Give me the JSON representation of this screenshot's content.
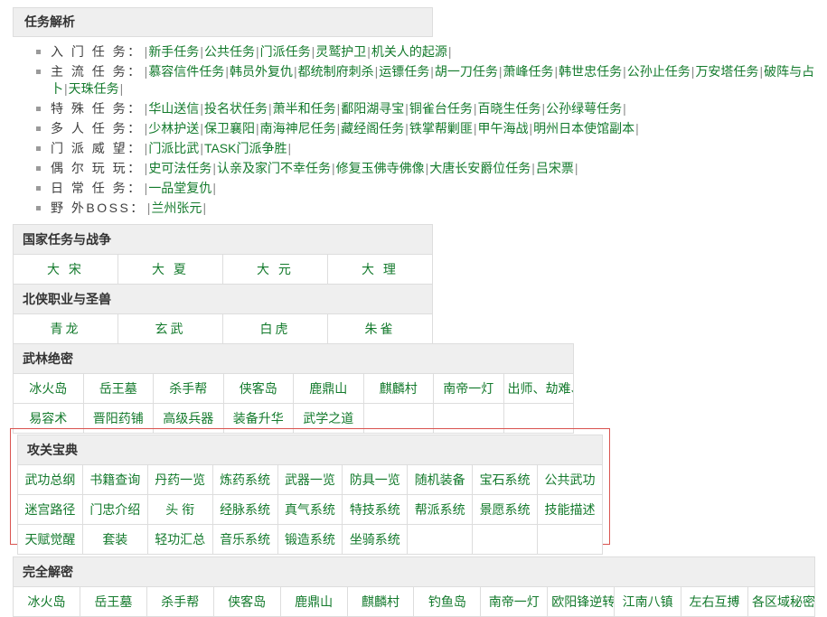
{
  "task_parse": {
    "title": "任务解析",
    "rows": [
      {
        "label": "入 门 任 务：",
        "links": [
          "新手任务",
          "公共任务",
          "门派任务",
          "灵鹫护卫",
          "机关人的起源"
        ]
      },
      {
        "label": "主 流 任 务：",
        "links": [
          "慕容信件任务",
          "韩员外复仇",
          "都统制府刺杀",
          "运镖任务",
          "胡一刀任务",
          "萧峰任务",
          "韩世忠任务",
          "公孙止任务",
          "万安塔任务",
          "破阵与占卜",
          "天珠任务"
        ]
      },
      {
        "label": "特 殊 任 务：",
        "links": [
          "华山送信",
          "投名状任务",
          "萧半和任务",
          "鄱阳湖寻宝",
          "铜雀台任务",
          "百晓生任务",
          "公孙绿萼任务"
        ]
      },
      {
        "label": "多 人 任 务：",
        "links": [
          "少林护送",
          "保卫襄阳",
          "南海神尼任务",
          "藏经阁任务",
          "铁掌帮剿匪",
          "甲午海战",
          "明州日本使馆副本"
        ]
      },
      {
        "label": "门 派 威 望：",
        "links": [
          "门派比武",
          "TASK门派争胜"
        ]
      },
      {
        "label": "偶 尔 玩 玩：",
        "links": [
          "史可法任务",
          "认亲及家门不幸任务",
          "修复玉佛寺佛像",
          "大唐长安爵位任务",
          "吕宋票"
        ]
      },
      {
        "label": "日 常 任 务：",
        "links": [
          "一品堂复仇"
        ]
      },
      {
        "label": "野 外BOSS：",
        "links": [
          "兰州张元"
        ]
      }
    ]
  },
  "nation_table": {
    "sections": [
      {
        "title": "国家任务与战争",
        "cells": [
          "大 宋",
          "大 夏",
          "大 元",
          "大 理"
        ]
      },
      {
        "title": "北侠职业与圣兽",
        "cells": [
          "青龙",
          "玄武",
          "白虎",
          "朱雀"
        ]
      }
    ]
  },
  "wulin_table": {
    "title": "武林绝密",
    "rows": [
      [
        "冰火岛",
        "岳王墓",
        "杀手帮",
        "侠客岛",
        "鹿鼎山",
        "麒麟村",
        "南帝一灯",
        "出师、劫难、宗师挑战"
      ],
      [
        "易容术",
        "晋阳药铺",
        "高级兵器",
        "装备升华",
        "武学之道",
        "",
        "",
        ""
      ]
    ]
  },
  "gongguan_table": {
    "title": "攻关宝典",
    "highlight_color": "#d9534f",
    "rows": [
      [
        "武功总纲",
        "书籍查询",
        "丹药一览",
        "炼药系统",
        "武器一览",
        "防具一览",
        "随机装备",
        "宝石系统",
        "公共武功"
      ],
      [
        "迷宫路径",
        "门忠介绍",
        "头 衔",
        "经脉系统",
        "真气系统",
        "特技系统",
        "帮派系统",
        "景愿系统",
        "技能描述"
      ],
      [
        "天赋觉醒",
        "套装",
        "轻功汇总",
        "音乐系统",
        "锻造系统",
        "坐骑系统",
        "",
        "",
        ""
      ]
    ]
  },
  "jiemi_table": {
    "title": "完全解密",
    "rows": [
      [
        "冰火岛",
        "岳王墓",
        "杀手帮",
        "侠客岛",
        "鹿鼎山",
        "麒麟村",
        "钓鱼岛",
        "南帝一灯",
        "欧阳锋逆转经脉",
        "江南八镇",
        "左右互搏",
        "各区域秘密（求完善）"
      ]
    ]
  },
  "colors": {
    "link_green": "#137a2c",
    "header_bg": "#efefef",
    "border": "#dddddd",
    "highlight_red": "#d9534f"
  }
}
